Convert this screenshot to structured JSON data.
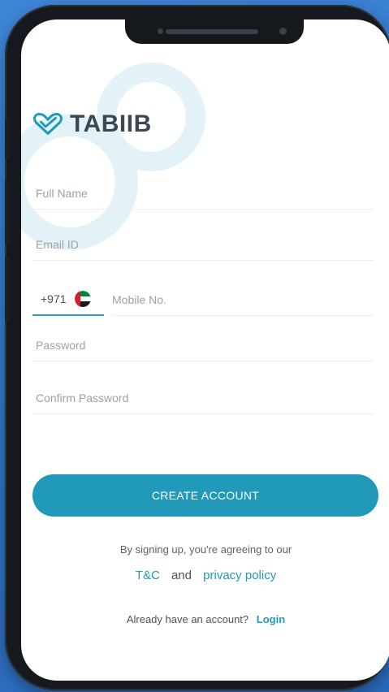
{
  "app": {
    "brand": "TABIIB"
  },
  "form": {
    "full_name_placeholder": "Full Name",
    "email_placeholder": "Email ID",
    "country_code": "+971",
    "mobile_placeholder": "Mobile No.",
    "password_placeholder": "Password",
    "confirm_password_placeholder": "Confirm Password"
  },
  "actions": {
    "create_account_label": "CREATE ACCOUNT"
  },
  "legal": {
    "agree_text": "By signing up, you're agreeing to our",
    "tc_label": "T&C",
    "and_text": "and",
    "privacy_label": "privacy policy"
  },
  "footer": {
    "have_account_text": "Already have an account?",
    "login_label": "Login"
  },
  "colors": {
    "accent": "#2199b8",
    "text_dark": "#3d4653",
    "placeholder": "#9aa1a8",
    "background_blue": "#2f74c8"
  },
  "icons": [
    "tabiib-logo-icon",
    "uae-flag-icon"
  ]
}
